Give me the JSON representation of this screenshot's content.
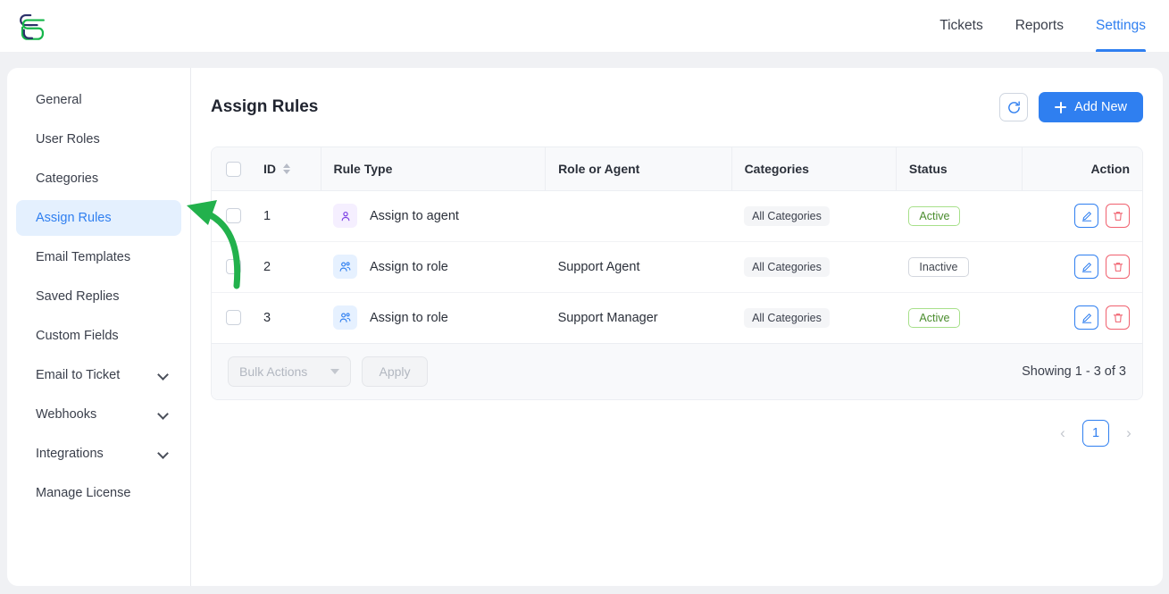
{
  "brand": {
    "logo_alt": "company-logo",
    "navy": "#2b3069",
    "green": "#15b64a"
  },
  "topnav": {
    "items": [
      {
        "label": "Tickets",
        "active": false
      },
      {
        "label": "Reports",
        "active": false
      },
      {
        "label": "Settings",
        "active": true
      }
    ]
  },
  "sidebar": {
    "items": [
      {
        "label": "General",
        "active": false,
        "expandable": false
      },
      {
        "label": "User Roles",
        "active": false,
        "expandable": false
      },
      {
        "label": "Categories",
        "active": false,
        "expandable": false
      },
      {
        "label": "Assign Rules",
        "active": true,
        "expandable": false
      },
      {
        "label": "Email Templates",
        "active": false,
        "expandable": false
      },
      {
        "label": "Saved Replies",
        "active": false,
        "expandable": false
      },
      {
        "label": "Custom Fields",
        "active": false,
        "expandable": false
      },
      {
        "label": "Email to Ticket",
        "active": false,
        "expandable": true
      },
      {
        "label": "Webhooks",
        "active": false,
        "expandable": true
      },
      {
        "label": "Integrations",
        "active": false,
        "expandable": true
      },
      {
        "label": "Manage License",
        "active": false,
        "expandable": false
      }
    ]
  },
  "main": {
    "page_title": "Assign Rules",
    "refresh_label": "Refresh",
    "add_new_label": "Add New",
    "table": {
      "columns": [
        "ID",
        "Rule Type",
        "Role or Agent",
        "Categories",
        "Status",
        "Action"
      ],
      "rows": [
        {
          "id": "1",
          "rule_type": "Assign to agent",
          "rule_icon": "user-icon",
          "role_or_agent": "",
          "categories": "All Categories",
          "status": "Active",
          "status_kind": "active",
          "edit_label": "Edit",
          "delete_label": "Delete"
        },
        {
          "id": "2",
          "rule_type": "Assign to role",
          "rule_icon": "users-icon",
          "role_or_agent": "Support Agent",
          "categories": "All Categories",
          "status": "Inactive",
          "status_kind": "inactive",
          "edit_label": "Edit",
          "delete_label": "Delete"
        },
        {
          "id": "3",
          "rule_type": "Assign to role",
          "rule_icon": "users-icon",
          "role_or_agent": "Support Manager",
          "categories": "All Categories",
          "status": "Active",
          "status_kind": "active",
          "edit_label": "Edit",
          "delete_label": "Delete"
        }
      ]
    },
    "footer": {
      "bulk_actions_label": "Bulk Actions",
      "apply_label": "Apply",
      "showing_text": "Showing 1 - 3 of 3"
    },
    "pagination": {
      "prev": "‹",
      "current_page": "1",
      "next": "›"
    }
  },
  "annotation": {
    "arrow_color": "#22b14c",
    "points_to": "Assign Rules"
  }
}
